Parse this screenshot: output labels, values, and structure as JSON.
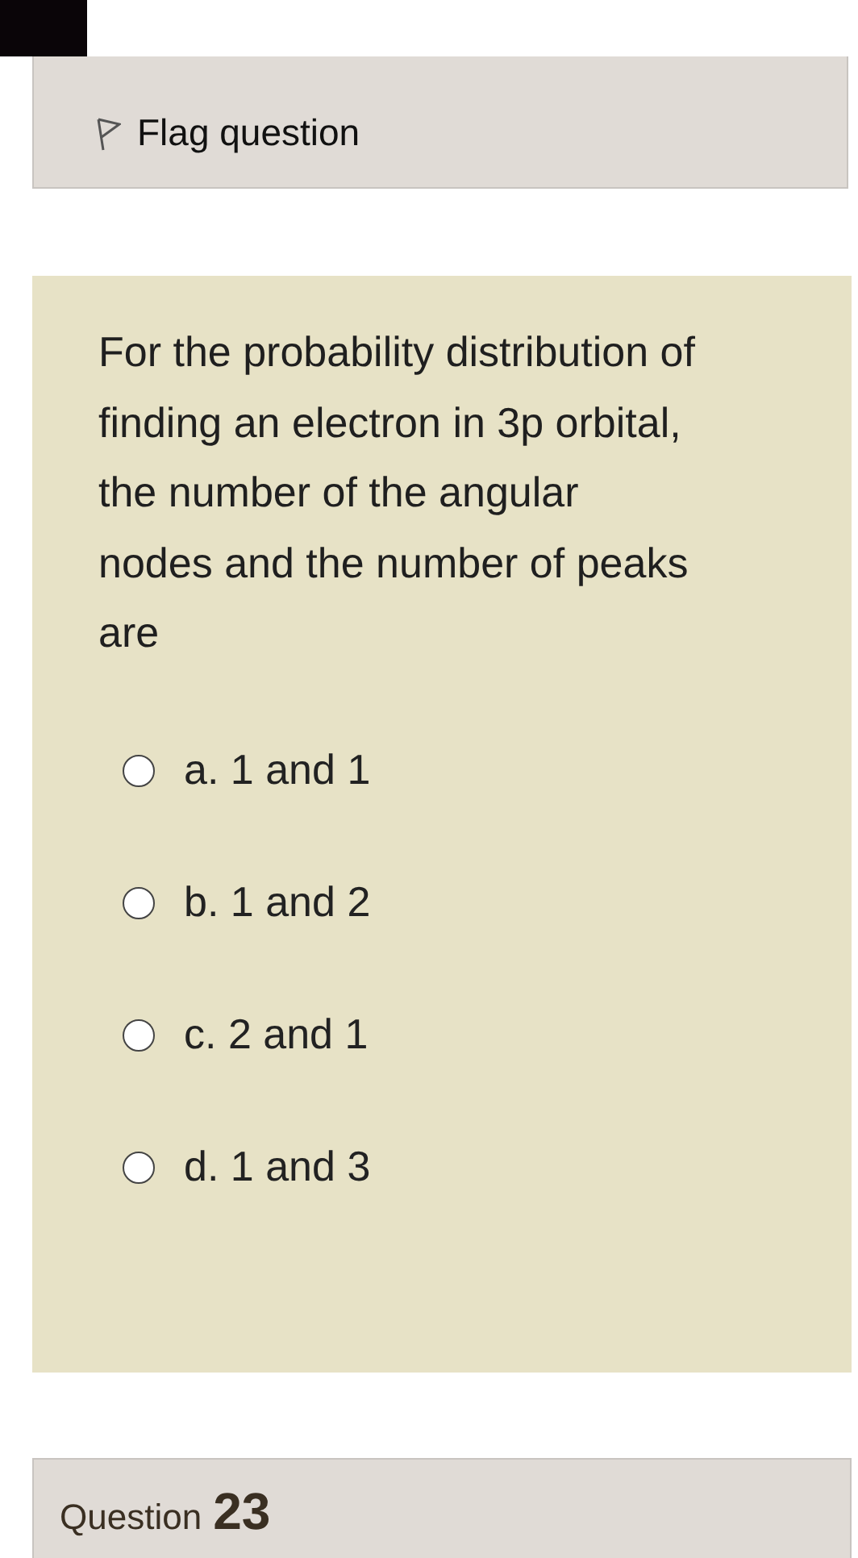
{
  "info": {
    "flag_label": "Flag question",
    "flagged": false
  },
  "question": {
    "text": "For the probability distribution of finding an electron in 3p orbital, the number of the angular nodes and the number of peaks are",
    "options": [
      {
        "label": "a. 1 and 1",
        "selected": false
      },
      {
        "label": "b. 1 and 2",
        "selected": false
      },
      {
        "label": "c. 2 and 1",
        "selected": false
      },
      {
        "label": "d. 1 and 3",
        "selected": false
      }
    ]
  },
  "next_question": {
    "label": "Question",
    "number": "23"
  }
}
